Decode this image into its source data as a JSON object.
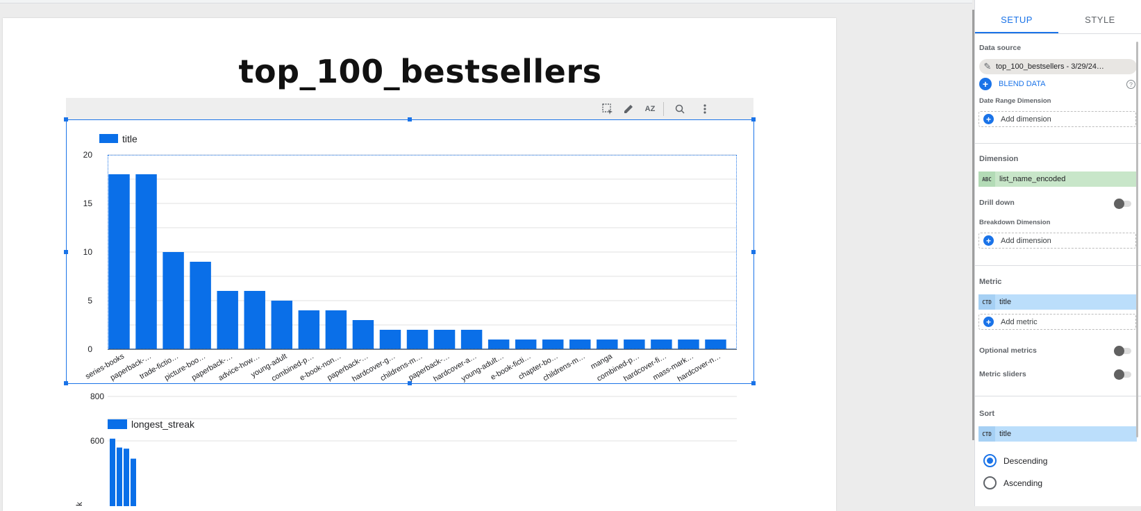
{
  "report": {
    "title": "top_100_bestsellers"
  },
  "toolbar": {
    "icons": [
      "select-icon",
      "edit-icon",
      "sort-az-icon",
      "zoom-icon",
      "more-vert-icon"
    ],
    "sort_label": "AZ"
  },
  "chart_data": [
    {
      "type": "bar",
      "legend": "title",
      "legend_position": "top-left",
      "categories": [
        "series-books",
        "paperback-…",
        "trade-fictio…",
        "picture-boo…",
        "paperback-…",
        "advice-how…",
        "young-adult",
        "combined-p…",
        "e-book-non…",
        "paperback-…",
        "hardcover-g…",
        "childrens-m…",
        "paperback-…",
        "hardcover-a…",
        "young-adult…",
        "e-book-ficti…",
        "chapter-bo…",
        "childrens-m…",
        "manga",
        "combined-p…",
        "hardcover-fi…",
        "mass-mark…",
        "hardcover-n…"
      ],
      "values": [
        18,
        18,
        10,
        9,
        6,
        6,
        5,
        4,
        4,
        3,
        2,
        2,
        2,
        2,
        1,
        1,
        1,
        1,
        1,
        1,
        1,
        1,
        1
      ],
      "ylim": [
        0,
        20
      ],
      "yticks": [
        "0",
        "5",
        "10",
        "15",
        "20"
      ],
      "grid": true,
      "color": "#0a6fe8"
    },
    {
      "type": "bar",
      "legend": "longest_streak",
      "legend_position": "top-left",
      "values": [
        610,
        570,
        565,
        520
      ],
      "ylim": [
        0,
        800
      ],
      "yticks": [
        "600",
        "800"
      ],
      "ylabel": "k",
      "grid": true,
      "color": "#0a6fe8"
    }
  ],
  "panel": {
    "tabs": [
      "SETUP",
      "STYLE"
    ],
    "active_tab": "SETUP",
    "data_source_label": "Data source",
    "data_source_value": "top_100_bestsellers - 3/29/24…",
    "blend_label": "BLEND DATA",
    "help": "?",
    "date_range_label": "Date Range Dimension",
    "add_dimension": "Add dimension",
    "dimension_label": "Dimension",
    "dimension_type": "ABC",
    "dimension_value": "list_name_encoded",
    "drill_down_label": "Drill down",
    "breakdown_label": "Breakdown Dimension",
    "metric_label": "Metric",
    "metric_type": "CTD",
    "metric_value": "title",
    "add_metric": "Add metric",
    "optional_metrics_label": "Optional metrics",
    "metric_sliders_label": "Metric sliders",
    "sort_label": "Sort",
    "sort_type": "CTD",
    "sort_value": "title",
    "descending": "Descending",
    "ascending": "Ascending",
    "sort_order": "Descending",
    "drill_down_on": false,
    "optional_metrics_on": false,
    "metric_sliders_on": false
  }
}
